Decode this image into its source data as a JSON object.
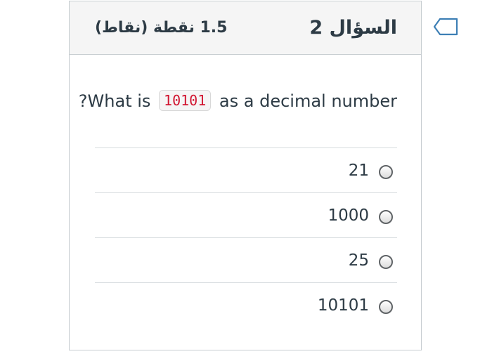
{
  "question": {
    "title": "السؤال 2",
    "points": "1.5 نقطة (نقاط)",
    "text_before": "What is",
    "code": "10101",
    "text_after": "as a decimal number",
    "punctuation": "?"
  },
  "answers": [
    {
      "label": "21"
    },
    {
      "label": "1000"
    },
    {
      "label": "25"
    },
    {
      "label": "10101"
    }
  ],
  "icons": {
    "flag": "flag-question-icon",
    "radio": "radio-button-icon"
  }
}
